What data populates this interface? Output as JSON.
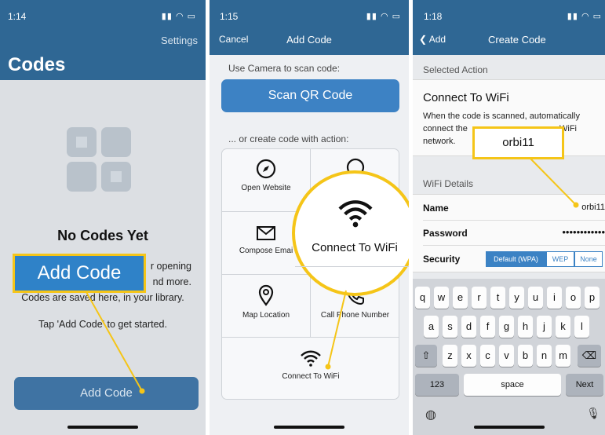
{
  "colors": {
    "nav": "#2f6794",
    "accent": "#3d82c4",
    "callout_border": "#f5c518"
  },
  "panel1": {
    "status_time": "1:14",
    "settings": "Settings",
    "title": "Codes",
    "empty_title": "No Codes Yet",
    "desc_line1": "r opening",
    "desc_line2": "nd more.",
    "desc_line3": "Codes are saved here, in your library.",
    "hint": "Tap 'Add Code' to get started.",
    "add_button": "Add Code",
    "callout": "Add Code"
  },
  "panel2": {
    "status_time": "1:15",
    "cancel": "Cancel",
    "title": "Add Code",
    "camera_caption": "Use Camera to scan code:",
    "scan_button": "Scan QR Code",
    "or_caption": "... or create code with action:",
    "actions": {
      "open_website": "Open Website",
      "compose_email": "Compose Emai",
      "map_location": "Map Location",
      "call_phone": "Call Phone Number",
      "connect_wifi": "Connect To WiFi"
    },
    "magnifier_label": "Connect To WiFi"
  },
  "panel3": {
    "status_time": "1:18",
    "back": "Add",
    "title": "Create Code",
    "selected_action_header": "Selected Action",
    "action_title": "Connect To WiFi",
    "action_desc_line1": "When the code is scanned, automatically",
    "action_desc_line2a": "connect the",
    "action_desc_line2b": "WiFi",
    "action_desc_line3": "network.",
    "wifi_header": "WiFi Details",
    "name_label": "Name",
    "name_value": "orbi11",
    "password_label": "Password",
    "password_value": "••••••••••••",
    "security_label": "Security",
    "security_options": [
      "Default (WPA)",
      "WEP",
      "None"
    ],
    "callout": "orbi11",
    "keyboard": {
      "row1": [
        "q",
        "w",
        "e",
        "r",
        "t",
        "y",
        "u",
        "i",
        "o",
        "p"
      ],
      "row2": [
        "a",
        "s",
        "d",
        "f",
        "g",
        "h",
        "j",
        "k",
        "l"
      ],
      "row3": [
        "z",
        "x",
        "c",
        "v",
        "b",
        "n",
        "m"
      ],
      "num": "123",
      "space": "space",
      "next": "Next"
    }
  }
}
